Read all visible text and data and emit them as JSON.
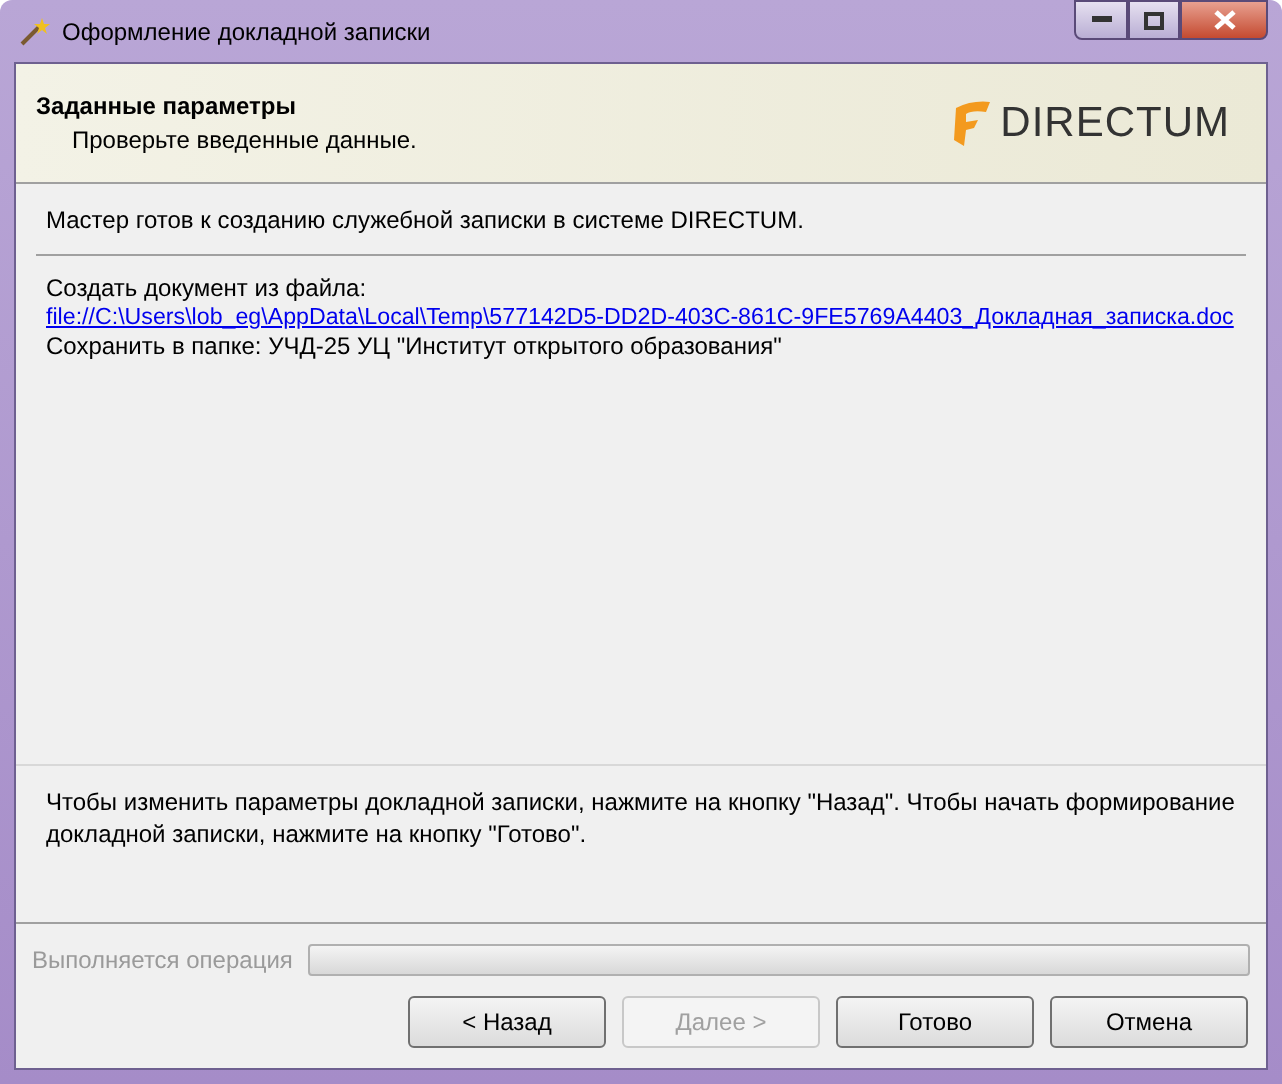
{
  "window": {
    "title": "Оформление докладной записки"
  },
  "header": {
    "title": "Заданные параметры",
    "subtitle": "Проверьте введенные данные.",
    "logo_text": "DIRECTUM"
  },
  "intro": "Мастер готов к созданию служебной записки в системе DIRECTUM.",
  "details": [
    {
      "kind": "text",
      "text": "Создать документ из файла:"
    },
    {
      "kind": "link",
      "text": "file://C:\\Users\\lob_eg\\AppData\\Local\\Temp\\577142D5-DD2D-403C-861C-9FE5769A4403_Докладная_записка.doc"
    },
    {
      "kind": "text",
      "text": "Сохранить в папке: УЧД-25 УЦ \"Институт открытого образования\""
    }
  ],
  "hint": "Чтобы изменить параметры докладной записки, нажмите на кнопку \"Назад\". Чтобы начать формирование докладной записки, нажмите на кнопку \"Готово\".",
  "progress": {
    "label": "Выполняется операция",
    "level": 0
  },
  "buttons": [
    {
      "label": "< Назад",
      "disabled": false
    },
    {
      "label": "Далее >",
      "disabled": true
    },
    {
      "label": "Готово",
      "disabled": false
    },
    {
      "label": "Отмена",
      "disabled": false
    }
  ]
}
